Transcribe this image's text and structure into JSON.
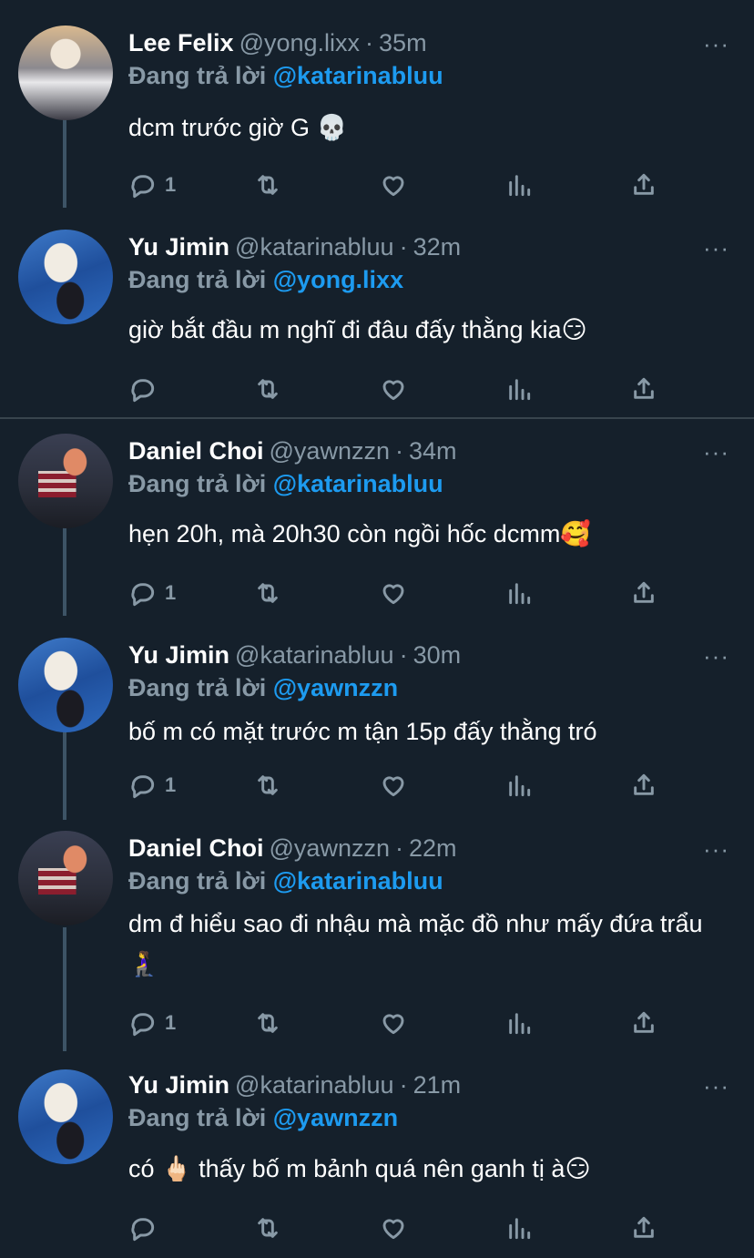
{
  "replying_prefix": "Đang trả lời",
  "more_glyph": "···",
  "tweets": [
    {
      "name": "Lee Felix",
      "handle": "@yong.lixx",
      "time": "35m",
      "reply_to": "@katarinabluu",
      "text": "dcm trước giờ G 💀",
      "reply_count": "1",
      "avatar": "felix"
    },
    {
      "name": "Yu Jimin",
      "handle": "@katarinabluu",
      "time": "32m",
      "reply_to": "@yong.lixx",
      "text": "giờ bắt đầu m nghĩ đi đâu đấy thằng kia😏",
      "reply_count": "",
      "avatar": "jimin"
    },
    {
      "name": "Daniel Choi",
      "handle": "@yawnzzn",
      "time": "34m",
      "reply_to": "@katarinabluu",
      "text": "hẹn 20h, mà 20h30 còn ngồi hốc dcmm🥰",
      "reply_count": "1",
      "avatar": "daniel"
    },
    {
      "name": "Yu Jimin",
      "handle": "@katarinabluu",
      "time": "30m",
      "reply_to": "@yawnzzn",
      "text": "bố m có mặt trước m tận 15p đấy thằng tró",
      "reply_count": "1",
      "avatar": "jimin"
    },
    {
      "name": "Daniel Choi",
      "handle": "@yawnzzn",
      "time": "22m",
      "reply_to": "@katarinabluu",
      "text": "dm đ hiểu sao đi nhậu mà mặc đồ như mấy đứa trẩu🧎‍♀️",
      "reply_count": "1",
      "avatar": "daniel"
    },
    {
      "name": "Yu Jimin",
      "handle": "@katarinabluu",
      "time": "21m",
      "reply_to": "@yawnzzn",
      "text": "có 🖕🏻  thấy bố m bảnh quá nên ganh tị à😏",
      "reply_count": "",
      "avatar": "jimin"
    }
  ]
}
